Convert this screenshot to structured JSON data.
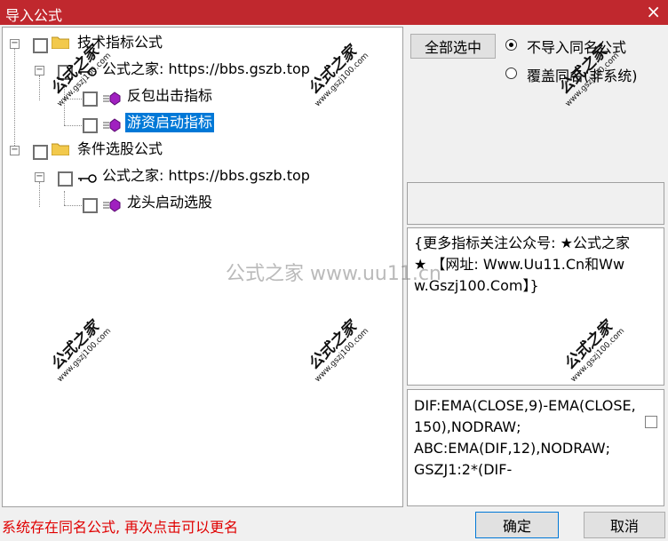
{
  "dialog": {
    "title": "导入公式",
    "close_label": "×",
    "status_message": "系统存在同名公式, 再次点击可以更名",
    "ok_label": "确定",
    "cancel_label": "取消"
  },
  "tree": [
    {
      "label": "技术指标公式",
      "children": [
        {
          "label": "公式之家: https://bbs.gszb.top",
          "children": [
            {
              "label": "反包出击指标",
              "selected": false
            },
            {
              "label": "游资启动指标",
              "selected": true
            }
          ]
        }
      ]
    },
    {
      "label": "条件选股公式",
      "children": [
        {
          "label": "公式之家: https://bbs.gszb.top",
          "children": [
            {
              "label": "龙头启动选股",
              "selected": false
            }
          ]
        }
      ]
    }
  ],
  "options": {
    "select_all_label": "全部选中",
    "radio_skip_label": "不导入同名公式",
    "radio_overwrite_label": "覆盖同名(非系统)",
    "selected": "skip"
  },
  "description": "{更多指标关注公众号: ★公式之家★ 【网址: Www.Uu11.Cn和Www.Gszj100.Com】}",
  "code": "DIF:EMA(CLOSE,9)-EMA(CLOSE,150),NODRAW;\nABC:EMA(DIF,12),NODRAW;\nGSZJ1:2*(DIF-",
  "watermarks": {
    "center": "公式之家 www.uu11.cn",
    "stamp_main": "公式之家",
    "stamp_sub": "www.gszj100.com"
  },
  "colors": {
    "title_bar": "#C0282E",
    "selection": "#0078D7",
    "status_text": "#E00000",
    "folder": "#F2C94C",
    "formula_icon": "#A020C0"
  }
}
